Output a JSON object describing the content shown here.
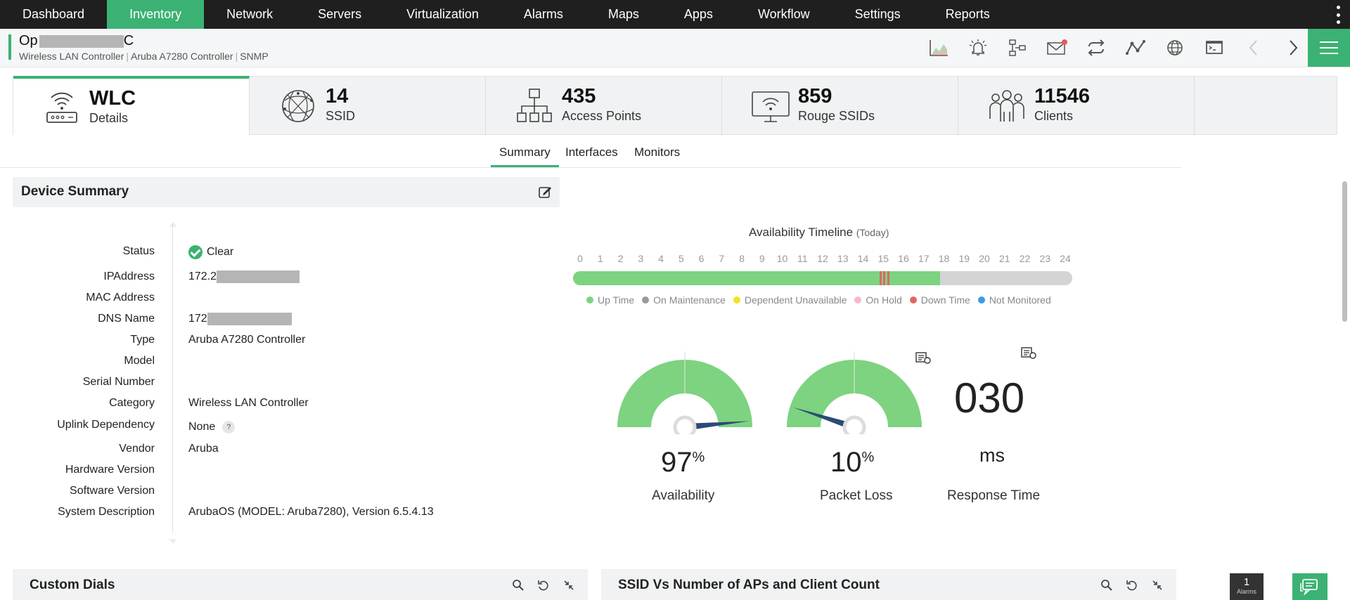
{
  "topnav": {
    "items": [
      "Dashboard",
      "Inventory",
      "Network",
      "Servers",
      "Virtualization",
      "Alarms",
      "Maps",
      "Apps",
      "Workflow",
      "Settings",
      "Reports"
    ],
    "active": "Inventory"
  },
  "device": {
    "name_prefix": "Op",
    "name_suffix": "C",
    "sub": [
      "Wireless LAN Controller",
      "Aruba A7280 Controller",
      "SNMP"
    ]
  },
  "tiles": [
    {
      "num": "WLC",
      "label": "Details",
      "icon": "wlc-router-icon"
    },
    {
      "num": "14",
      "label": "SSID",
      "icon": "globe-icon"
    },
    {
      "num": "435",
      "label": "Access Points",
      "icon": "network-tree-icon"
    },
    {
      "num": "859",
      "label": "Rouge SSIDs",
      "icon": "monitor-wifi-icon"
    },
    {
      "num": "11546",
      "label": "Clients",
      "icon": "users-icon"
    }
  ],
  "tabs": [
    "Summary",
    "Interfaces",
    "Monitors"
  ],
  "device_summary": {
    "title": "Device Summary",
    "fields": [
      {
        "key": "Status",
        "value": "Clear"
      },
      {
        "key": "IPAddress",
        "value": "172.2"
      },
      {
        "key": "MAC Address",
        "value": ""
      },
      {
        "key": "DNS Name",
        "value": "172"
      },
      {
        "key": "Type",
        "value": "Aruba A7280 Controller"
      },
      {
        "key": "Model",
        "value": ""
      },
      {
        "key": "Serial Number",
        "value": ""
      },
      {
        "key": "Category",
        "value": "Wireless LAN Controller"
      },
      {
        "key": "Uplink Dependency",
        "value": "None"
      },
      {
        "key": "Vendor",
        "value": "Aruba"
      },
      {
        "key": "Hardware Version",
        "value": ""
      },
      {
        "key": "Software Version",
        "value": ""
      },
      {
        "key": "System Description",
        "value": "ArubaOS (MODEL: Aruba7280), Version 6.5.4.13"
      }
    ],
    "help_glyph": "?"
  },
  "availability": {
    "title": "Availability Timeline",
    "period": "(Today)",
    "hours": [
      "0",
      "1",
      "2",
      "3",
      "4",
      "5",
      "6",
      "7",
      "8",
      "9",
      "10",
      "11",
      "12",
      "13",
      "14",
      "15",
      "16",
      "17",
      "18",
      "19",
      "20",
      "21",
      "22",
      "23",
      "24"
    ],
    "up_until_hour": 17.8,
    "down_marks_hours": [
      14.8,
      15.0,
      15.2
    ],
    "legend": [
      {
        "label": "Up Time",
        "color": "#7dd37f"
      },
      {
        "label": "On Maintenance",
        "color": "#999999"
      },
      {
        "label": "Dependent Unavailable",
        "color": "#f2e31b"
      },
      {
        "label": "On Hold",
        "color": "#f6b8c4"
      },
      {
        "label": "Down Time",
        "color": "#e06666"
      },
      {
        "label": "Not Monitored",
        "color": "#3a9be0"
      }
    ]
  },
  "gauges": {
    "availability": {
      "value": "97",
      "unit": "%",
      "label": "Availability",
      "fraction": 0.97
    },
    "packet_loss": {
      "value": "10",
      "unit": "%",
      "label": "Packet Loss",
      "fraction": 0.1
    },
    "response_time": {
      "value": "030",
      "unit": "ms",
      "label": "Response Time"
    }
  },
  "bottom_panels": {
    "left_title": "Custom Dials",
    "right_title": "SSID Vs Number of APs and Client Count"
  },
  "alarms": {
    "count": "1",
    "label": "Alarms"
  },
  "colors": {
    "accent": "#3bb273",
    "nav_bg": "#1f1f1f",
    "gauge_green": "#7dd37f",
    "needle": "#2c4a75"
  }
}
